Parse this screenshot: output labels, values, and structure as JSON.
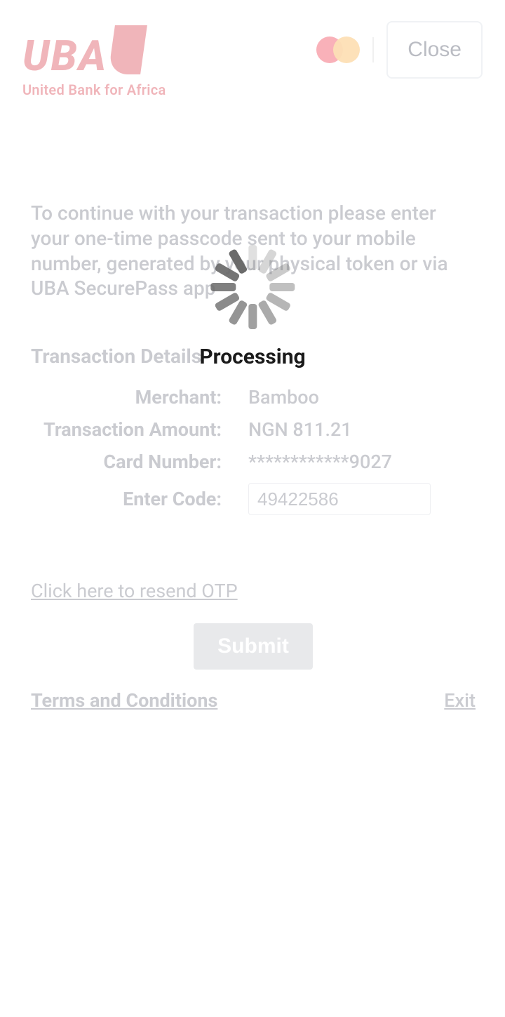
{
  "header": {
    "bank_name": "UBA",
    "bank_tagline": "United Bank for Africa",
    "close_label": "Close"
  },
  "instruction": "To continue with your transaction please enter your one-time passcode sent to your mobile number, generated by your physical token or via UBA SecurePass app",
  "section_title": "Transaction Details",
  "details": {
    "merchant_label": "Merchant:",
    "merchant_value": "Bamboo",
    "amount_label": "Transaction Amount:",
    "amount_value": "NGN 811.21",
    "card_label": "Card Number:",
    "card_value": "************9027",
    "code_label": "Enter Code:",
    "code_value": "49422586"
  },
  "links": {
    "resend": "Click here to resend OTP",
    "terms": "Terms and Conditions",
    "exit": "Exit"
  },
  "buttons": {
    "submit": "Submit"
  },
  "overlay": {
    "processing": "Processing"
  }
}
